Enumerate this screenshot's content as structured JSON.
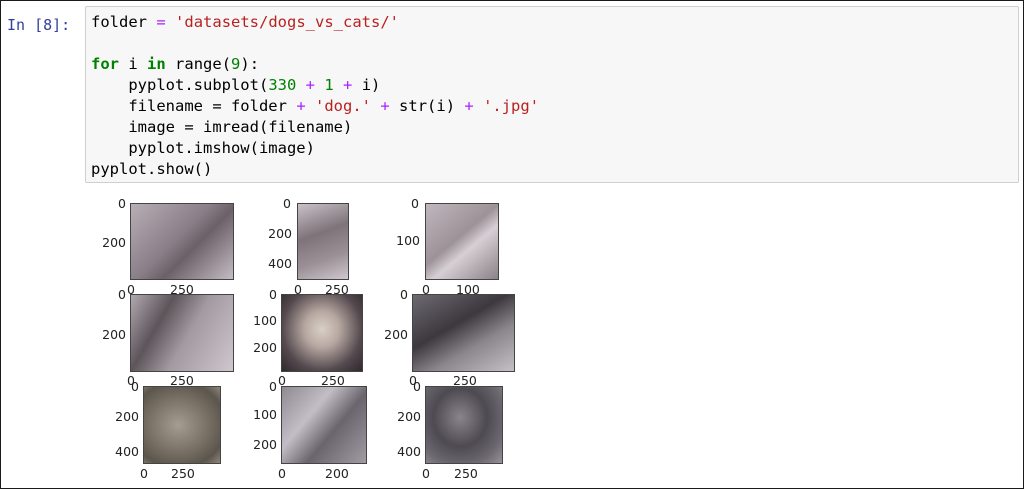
{
  "cell": {
    "prompt": "In [8]:",
    "code": {
      "line1": {
        "name": "folder",
        "op": "=",
        "value": "'datasets/dogs_vs_cats/'"
      },
      "line3": {
        "kw_for": "for",
        "var": "i",
        "kw_in": "in",
        "call": "range(",
        "num": "9",
        "end": "):"
      },
      "line4": {
        "pre": "    pyplot.subplot(",
        "n1": "330",
        "op1": "+",
        "n2": "1",
        "op2": "+",
        "post": "i)"
      },
      "line5": {
        "pre": "    filename = folder ",
        "op1": "+",
        "s1": "'dog.'",
        "op2": "+",
        "mid": "str(i)",
        "op3": "+",
        "s2": "'.jpg'"
      },
      "line6": {
        "text": "    image = imread(filename)"
      },
      "line7": {
        "text": "    pyplot.imshow(image)"
      },
      "line8": {
        "text": "pyplot.show()"
      }
    }
  },
  "output": {
    "subplots": [
      {
        "yticks": [
          "0",
          "200"
        ],
        "xticks": [
          "0",
          "250"
        ],
        "image_icon": "dog-photo-icon",
        "tone": "#9d9098"
      },
      {
        "yticks": [
          "0",
          "200",
          "400"
        ],
        "xticks": [
          "0",
          "250"
        ],
        "image_icon": "dog-photo-icon",
        "tone": "#a29aa0"
      },
      {
        "yticks": [
          "0",
          "100"
        ],
        "xticks": [
          "0",
          "100"
        ],
        "image_icon": "dog-photo-icon",
        "tone": "#a89ea6"
      },
      {
        "yticks": [
          "0",
          "200"
        ],
        "xticks": [
          "0",
          "250"
        ],
        "image_icon": "dog-photo-icon",
        "tone": "#a3999f"
      },
      {
        "yticks": [
          "0",
          "100",
          "200"
        ],
        "xticks": [
          "0",
          "250"
        ],
        "image_icon": "dog-photo-icon",
        "tone": "#8f8590"
      },
      {
        "yticks": [
          "0",
          "200"
        ],
        "xticks": [
          "0",
          "250"
        ],
        "image_icon": "dog-photo-icon",
        "tone": "#7e7a82"
      },
      {
        "yticks": [
          "0",
          "200",
          "400"
        ],
        "xticks": [
          "0",
          "250"
        ],
        "image_icon": "dog-photo-icon",
        "tone": "#8d8a82"
      },
      {
        "yticks": [
          "0",
          "100",
          "200"
        ],
        "xticks": [
          "0",
          "200"
        ],
        "image_icon": "dog-photo-icon",
        "tone": "#868088"
      },
      {
        "yticks": [
          "0",
          "200",
          "400"
        ],
        "xticks": [
          "0",
          "250"
        ],
        "image_icon": "dog-photo-icon",
        "tone": "#6f6a70"
      }
    ]
  }
}
